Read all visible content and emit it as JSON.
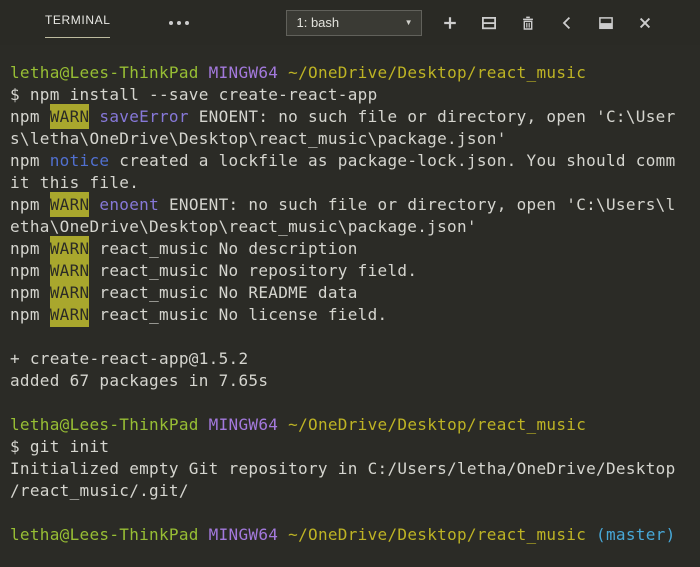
{
  "colors": {
    "background": "#2b2b26",
    "foreground": "#d5d5cf",
    "prompt_user_host_green": "#97be34",
    "prompt_mingw_purple": "#a379dc",
    "npm_code_purple": "#8678d8",
    "path_yellow": "#bdb324",
    "notice_blue": "#5170d0",
    "branch_cyan": "#47a8d8",
    "warn_badge_background": "#a9a72d",
    "warn_badge_text": "#2b2b26",
    "icon": "#cdcdcd",
    "tab_underline": "#bdbb9f"
  },
  "header": {
    "tab_label": "TERMINAL",
    "shell_selector": {
      "value": "1: bash",
      "arrow": "▼"
    },
    "icons": [
      "more-actions-icon",
      "new-terminal-icon",
      "split-terminal-icon",
      "kill-terminal-icon",
      "chevron-left-icon",
      "maximize-panel-icon",
      "close-panel-icon"
    ]
  },
  "terminal": {
    "lines": [
      [
        [
          "green",
          "letha@Lees-ThinkPad"
        ],
        [
          "fg",
          " "
        ],
        [
          "purple",
          "MINGW64"
        ],
        [
          "fg",
          " "
        ],
        [
          "yellow",
          "~/OneDrive/Desktop/react_music"
        ]
      ],
      [
        [
          "fg",
          "$ npm install --save create-react-app"
        ]
      ],
      [
        [
          "fg",
          "npm "
        ],
        [
          "warn",
          "WARN"
        ],
        [
          "fg",
          " "
        ],
        [
          "purple2",
          "saveError"
        ],
        [
          "fg",
          " ENOENT: no such file or directory, open 'C:\\User"
        ]
      ],
      [
        [
          "fg",
          "s\\letha\\OneDrive\\Desktop\\react_music\\package.json'"
        ]
      ],
      [
        [
          "fg",
          "npm "
        ],
        [
          "blue",
          "notice"
        ],
        [
          "fg",
          " created a lockfile as package-lock.json. You should comm"
        ]
      ],
      [
        [
          "fg",
          "it this file."
        ]
      ],
      [
        [
          "fg",
          "npm "
        ],
        [
          "warn",
          "WARN"
        ],
        [
          "fg",
          " "
        ],
        [
          "purple2",
          "enoent"
        ],
        [
          "fg",
          " ENOENT: no such file or directory, open 'C:\\Users\\l"
        ]
      ],
      [
        [
          "fg",
          "etha\\OneDrive\\Desktop\\react_music\\package.json'"
        ]
      ],
      [
        [
          "fg",
          "npm "
        ],
        [
          "warn",
          "WARN"
        ],
        [
          "fg",
          " react_music No description"
        ]
      ],
      [
        [
          "fg",
          "npm "
        ],
        [
          "warn",
          "WARN"
        ],
        [
          "fg",
          " react_music No repository field."
        ]
      ],
      [
        [
          "fg",
          "npm "
        ],
        [
          "warn",
          "WARN"
        ],
        [
          "fg",
          " react_music No README data"
        ]
      ],
      [
        [
          "fg",
          "npm "
        ],
        [
          "warn",
          "WARN"
        ],
        [
          "fg",
          " react_music No license field."
        ]
      ],
      [],
      [
        [
          "fg",
          "+ create-react-app@1.5.2"
        ]
      ],
      [
        [
          "fg",
          "added 67 packages in 7.65s"
        ]
      ],
      [],
      [
        [
          "green",
          "letha@Lees-ThinkPad"
        ],
        [
          "fg",
          " "
        ],
        [
          "purple",
          "MINGW64"
        ],
        [
          "fg",
          " "
        ],
        [
          "yellow",
          "~/OneDrive/Desktop/react_music"
        ]
      ],
      [
        [
          "fg",
          "$ git init"
        ]
      ],
      [
        [
          "fg",
          "Initialized empty Git repository in C:/Users/letha/OneDrive/Desktop"
        ]
      ],
      [
        [
          "fg",
          "/react_music/.git/"
        ]
      ],
      [],
      [
        [
          "green",
          "letha@Lees-ThinkPad"
        ],
        [
          "fg",
          " "
        ],
        [
          "purple",
          "MINGW64"
        ],
        [
          "fg",
          " "
        ],
        [
          "yellow",
          "~/OneDrive/Desktop/react_music"
        ],
        [
          "cyan",
          " (master)"
        ]
      ]
    ]
  }
}
